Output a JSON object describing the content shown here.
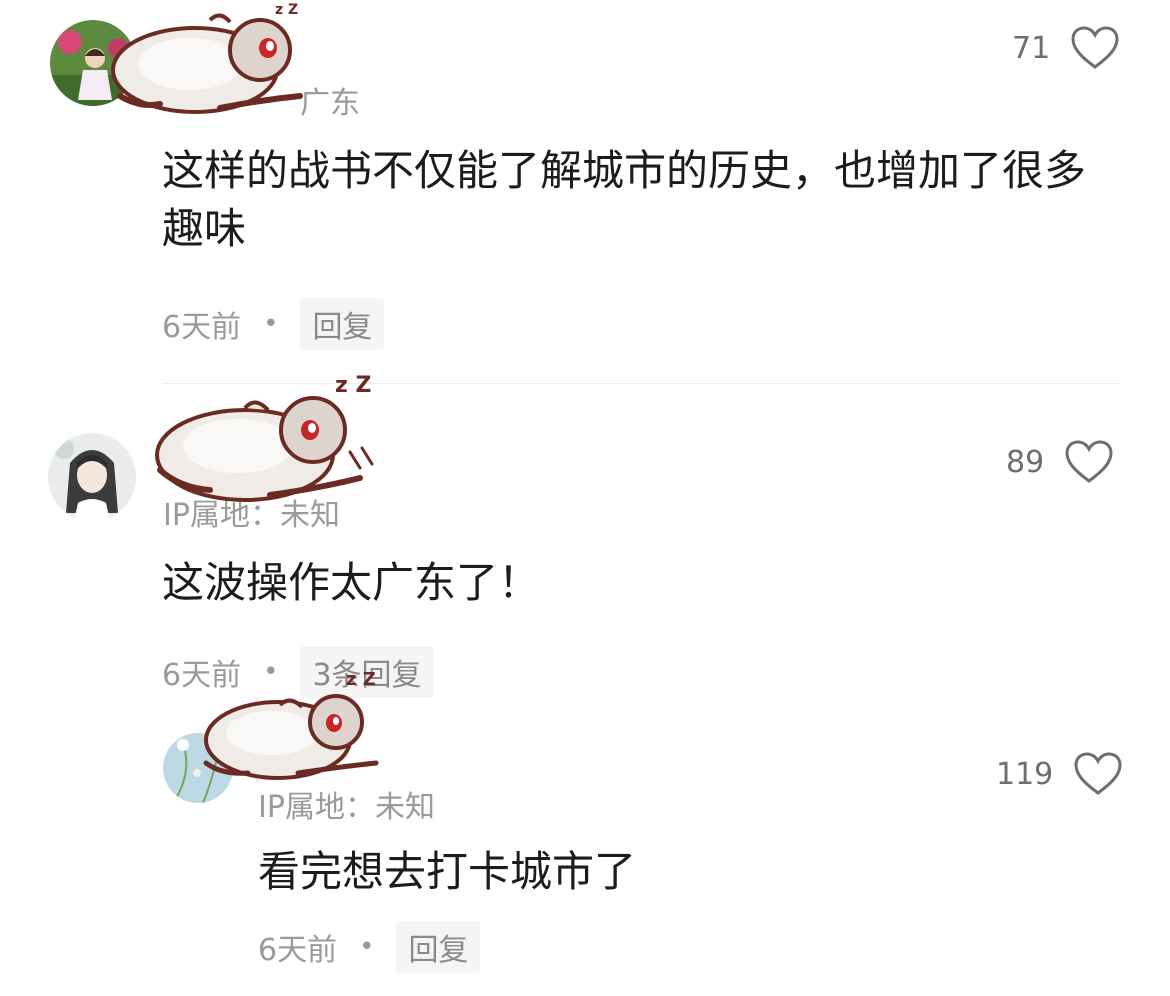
{
  "comments": [
    {
      "avatar_icon": "girl-photo-avatar",
      "ip_location": "广东",
      "text": "这样的战书不仅能了解城市的历史，也增加了很多趣味",
      "time": "6天前",
      "dot": "•",
      "reply_label": "回复",
      "likes": "71"
    },
    {
      "avatar_icon": "anime-girl-avatar",
      "ip_location": "IP属地：未知",
      "text": "这波操作太广东了！",
      "time": "6天前",
      "dot": "•",
      "reply_label": "3条回复",
      "likes": "89",
      "reply": {
        "avatar_icon": "flower-avatar",
        "ip_location": "IP属地：未知",
        "text": "看完想去打卡城市了",
        "time": "6天前",
        "dot": "•",
        "reply_label": "回复",
        "likes": "119"
      }
    }
  ],
  "sticker": {
    "icon": "sleeping-animal-sticker",
    "zz_text": "z Z"
  },
  "colors": {
    "text": "#1c1c1c",
    "meta": "#9a9a9a",
    "reply_bg": "#f5f5f5",
    "divider": "#ececec"
  }
}
